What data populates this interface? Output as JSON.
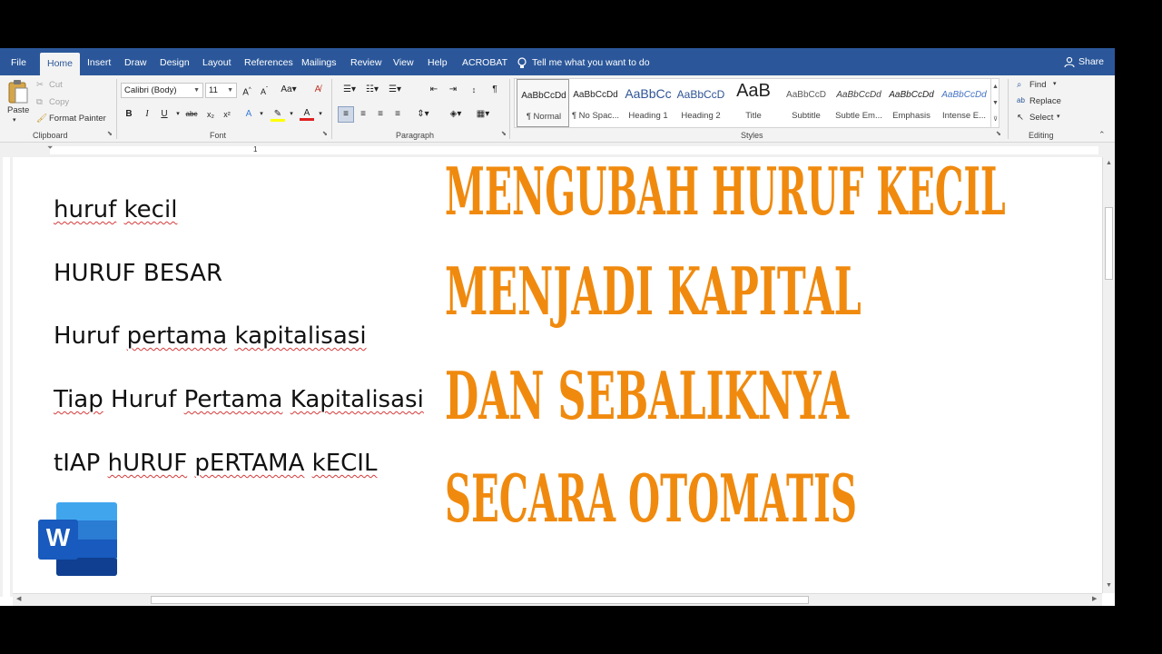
{
  "tabs": [
    "File",
    "Home",
    "Insert",
    "Draw",
    "Design",
    "Layout",
    "References",
    "Mailings",
    "Review",
    "View",
    "Help",
    "ACROBAT"
  ],
  "tell_me": "Tell me what you want to do",
  "share": "Share",
  "clipboard": {
    "paste": "Paste",
    "cut": "Cut",
    "copy": "Copy",
    "format_painter": "Format Painter",
    "label": "Clipboard"
  },
  "font": {
    "name": "Calibri (Body)",
    "size": "11",
    "label": "Font"
  },
  "paragraph": {
    "label": "Paragraph"
  },
  "styles": {
    "label": "Styles",
    "items": [
      {
        "preview": "AaBbCcDd",
        "name": "¶ Normal"
      },
      {
        "preview": "AaBbCcDd",
        "name": "¶ No Spac..."
      },
      {
        "preview": "AaBbCc",
        "name": "Heading 1"
      },
      {
        "preview": "AaBbCcD",
        "name": "Heading 2"
      },
      {
        "preview": "AaB",
        "name": "Title"
      },
      {
        "preview": "AaBbCcD",
        "name": "Subtitle"
      },
      {
        "preview": "AaBbCcDd",
        "name": "Subtle Em..."
      },
      {
        "preview": "AaBbCcDd",
        "name": "Emphasis"
      },
      {
        "preview": "AaBbCcDd",
        "name": "Intense E..."
      }
    ]
  },
  "editing": {
    "find": "Find",
    "replace": "Replace",
    "select": "Select",
    "label": "Editing"
  },
  "ruler_mark": "1",
  "document": {
    "lines": [
      {
        "words": [
          "huruf",
          "kecil"
        ]
      },
      {
        "words": [
          "HURUF",
          "BESAR"
        ]
      },
      {
        "words": [
          "Huruf",
          "pertama",
          "kapitalisasi"
        ]
      },
      {
        "words": [
          "Tiap",
          "Huruf",
          "Pertama",
          "Kapitalisasi"
        ]
      },
      {
        "words": [
          "tIAP",
          "hURUF",
          "pERTAMA",
          "kECIL"
        ]
      }
    ]
  },
  "overlay_title": [
    "MENGUBAH HURUF KECIL",
    "MENJADI KAPITAL",
    "DAN SEBALIKNYA",
    "SECARA OTOMATIS"
  ],
  "logo_letter": "W",
  "colors": {
    "word_blue": "#2b579a",
    "overlay_orange": "#f08a0e",
    "spell_red": "#d53a3a"
  }
}
